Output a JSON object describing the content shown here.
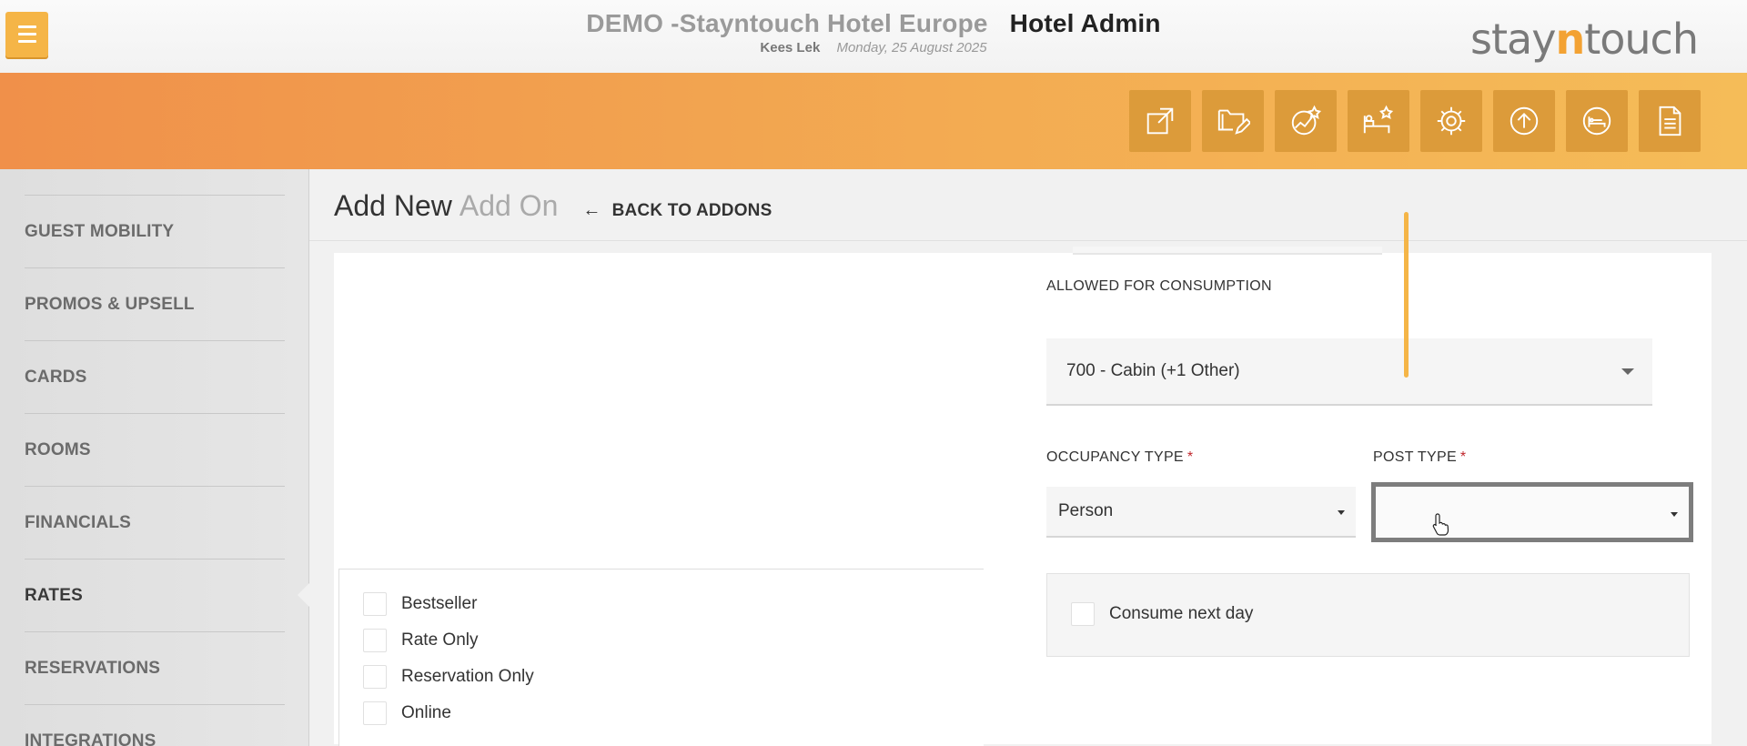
{
  "header": {
    "hotel": "DEMO -Stayntouch Hotel Europe",
    "app": "Hotel Admin",
    "user": "Kees Lek",
    "date": "Monday, 25 August 2025",
    "logo_left": "stay",
    "logo_n": "n",
    "logo_right": "touch"
  },
  "toolbar": {
    "icons": [
      "external-link-icon",
      "folder-edit-icon",
      "chart-star-icon",
      "bed-star-icon",
      "gear-icon",
      "upload-circle-icon",
      "bed-circle-icon",
      "document-icon"
    ]
  },
  "sidebar": {
    "items": [
      {
        "label": "GUEST MOBILITY"
      },
      {
        "label": "PROMOS & UPSELL"
      },
      {
        "label": "CARDS"
      },
      {
        "label": "ROOMS"
      },
      {
        "label": "FINANCIALS"
      },
      {
        "label": "RATES",
        "active": true
      },
      {
        "label": "RESERVATIONS"
      },
      {
        "label": "INTEGRATIONS"
      }
    ]
  },
  "page": {
    "title_main": "Add New",
    "title_sub": "Add On",
    "back_label": "BACK TO ADDONS"
  },
  "form": {
    "allowed_label": "ALLOWED FOR CONSUMPTION",
    "allowed_value": "700 - Cabin (+1 Other)",
    "occupancy_label": "OCCUPANCY TYPE",
    "occupancy_value": "Person",
    "post_type_label": "POST TYPE",
    "post_type_value": "",
    "required_mark": "*",
    "consume_next_day_label": "Consume next day",
    "checkboxes": [
      {
        "label": "Bestseller"
      },
      {
        "label": "Rate Only"
      },
      {
        "label": "Reservation Only"
      },
      {
        "label": "Online"
      }
    ]
  },
  "colors": {
    "accent": "#f5b547",
    "band_start": "#f0904a",
    "band_end": "#f5bc58",
    "tool_bg": "#dc9b3a",
    "required": "#c0262c"
  }
}
